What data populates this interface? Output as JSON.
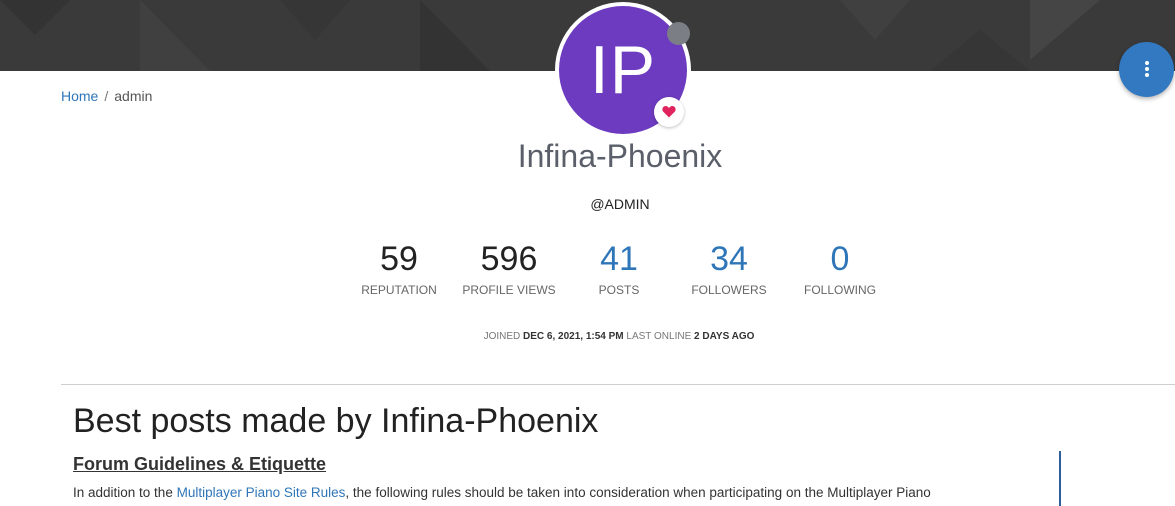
{
  "breadcrumb": {
    "home_label": "Home",
    "separator": "/",
    "current_label": "admin"
  },
  "profile": {
    "avatar_initials": "IP",
    "avatar_color": "#6d3bbf",
    "status_color": "#7b7f85",
    "status_icon": "status-dot-icon",
    "badge_icon": "heart-icon",
    "full_name": "Infina-Phoenix",
    "username": "@ADMIN"
  },
  "menu": {
    "icon": "kebab-vertical-icon",
    "color": "#3379c1"
  },
  "stats": [
    {
      "value": "59",
      "label": "REPUTATION",
      "link": false
    },
    {
      "value": "596",
      "label": "PROFILE VIEWS",
      "link": false
    },
    {
      "value": "41",
      "label": "POSTS",
      "link": true
    },
    {
      "value": "34",
      "label": "FOLLOWERS",
      "link": true
    },
    {
      "value": "0",
      "label": "FOLLOWING",
      "link": true
    }
  ],
  "joined": {
    "joined_label": "JOINED",
    "joined_value": "DEC 6, 2021, 1:54 PM",
    "last_online_label": "LAST ONLINE",
    "last_online_value": "2 DAYS AGO"
  },
  "best_posts": {
    "heading": "Best posts made by Infina-Phoenix",
    "post_title": "Forum Guidelines & Etiquette",
    "body_prefix": "In addition to the ",
    "body_link": "Multiplayer Piano Site Rules",
    "body_suffix": ", the following rules should be taken into consideration when participating on the Multiplayer Piano"
  },
  "colors": {
    "link": "#2f76b8",
    "cover": "#3a3a3a"
  }
}
